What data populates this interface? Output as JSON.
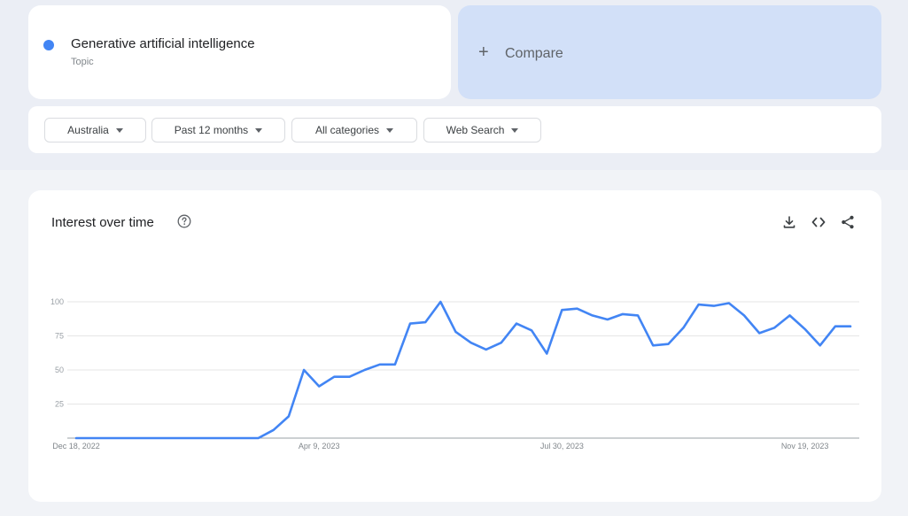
{
  "search_term": {
    "name": "Generative artificial intelligence",
    "type": "Topic",
    "color": "#4285f4"
  },
  "compare": {
    "label": "Compare",
    "icon": "plus-icon"
  },
  "filters": [
    {
      "label": "Australia"
    },
    {
      "label": "Past 12 months"
    },
    {
      "label": "All categories"
    },
    {
      "label": "Web Search"
    }
  ],
  "chart": {
    "title": "Interest over time",
    "icons": [
      "help-icon",
      "download-icon",
      "embed-code-icon",
      "share-icon"
    ]
  },
  "chart_data": {
    "type": "line",
    "title": "Interest over time",
    "xlabel": "",
    "ylabel": "",
    "ylim": [
      0,
      100
    ],
    "yticks": [
      25,
      50,
      75,
      100
    ],
    "x_tick_labels": [
      {
        "index": 0,
        "label": "Dec 18, 2022"
      },
      {
        "index": 16,
        "label": "Apr 9, 2023"
      },
      {
        "index": 32,
        "label": "Jul 30, 2023"
      },
      {
        "index": 48,
        "label": "Nov 19, 2023"
      }
    ],
    "grid": true,
    "color": "#4285f4",
    "series": [
      {
        "values": [
          0,
          0,
          0,
          0,
          0,
          0,
          0,
          0,
          0,
          0,
          0,
          0,
          0,
          6,
          16,
          50,
          38,
          45,
          45,
          50,
          54,
          54,
          84,
          85,
          100,
          78,
          70,
          65,
          70,
          84,
          79,
          62,
          94,
          95,
          90,
          87,
          91,
          90,
          68,
          69,
          81,
          98,
          97,
          99,
          90,
          77,
          81,
          90,
          80,
          68,
          82,
          82
        ]
      }
    ]
  }
}
